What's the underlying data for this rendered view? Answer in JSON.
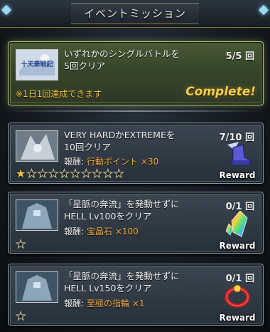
{
  "header": {
    "title": "イベントミッション"
  },
  "missions": [
    {
      "desc_line1": "いずれかのシングルバトルを",
      "desc_line2": "5回クリア",
      "progress": "5/5 回",
      "note": "※1日1回達成できます",
      "status": "Complete!",
      "thumb_text": "十天衆戦記"
    },
    {
      "desc_line1": "VERY HARDかEXTREMEを",
      "desc_line2": "10回クリア",
      "progress": "7/10 回",
      "reward_label": "報酬:",
      "reward_value": "行動ポイント ×30",
      "button_label": "Reward",
      "stars_filled": 1,
      "stars_total": 10
    },
    {
      "desc_line1": "「星脈の奔流」を発動せずに",
      "desc_line2": "HELL Lv100をクリア",
      "progress": "0/1 回",
      "reward_label": "報酬:",
      "reward_value": "宝晶石 ×100",
      "button_label": "Reward",
      "stars_filled": 0,
      "stars_total": 1
    },
    {
      "desc_line1": "「星脈の奔流」を発動せずに",
      "desc_line2": "HELL Lv150をクリア",
      "progress": "0/1 回",
      "reward_label": "報酬:",
      "reward_value": "至極の指輪 ×1",
      "button_label": "Reward",
      "stars_filled": 0,
      "stars_total": 1
    }
  ],
  "colors": {
    "accent": "#f3a940",
    "complete": "#f4cf52",
    "note": "#f3c64a"
  }
}
